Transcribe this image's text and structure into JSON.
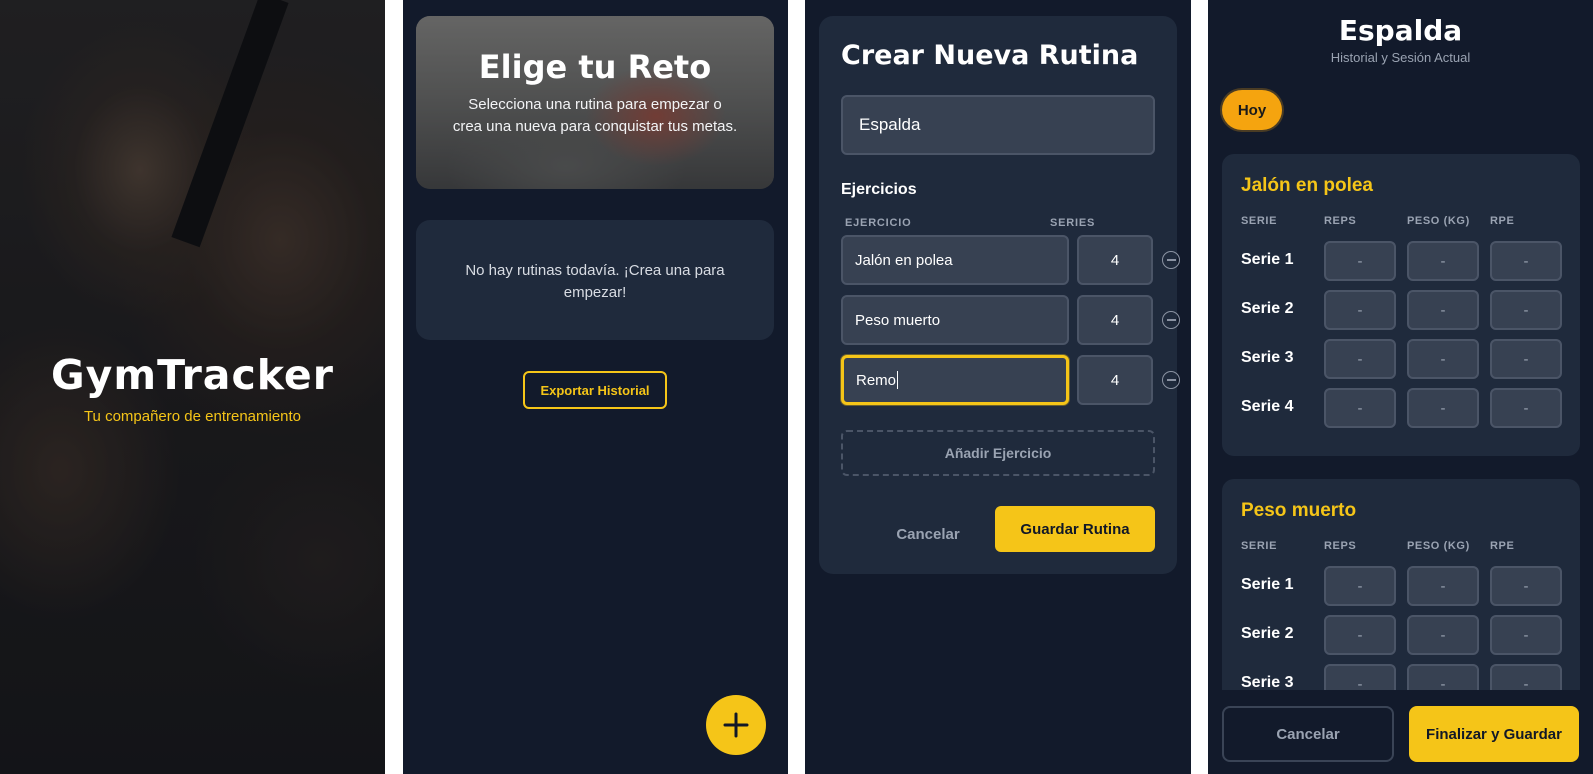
{
  "splash": {
    "title": "GymTracker",
    "subtitle": "Tu compañero de entrenamiento"
  },
  "challenges": {
    "title": "Elige tu Reto",
    "subtitle": "Selecciona una rutina para empezar o crea una nueva para conquistar tus metas.",
    "empty_message": "No hay rutinas todavía. ¡Crea una para empezar!",
    "export_label": "Exportar Historial",
    "fab_icon": "plus-icon"
  },
  "create": {
    "title": "Crear Nueva Rutina",
    "name_value": "Espalda",
    "exercises_label": "Ejercicios",
    "col_exercise": "EJERCICIO",
    "col_series": "SERIES",
    "exercises": [
      {
        "name": "Jalón en polea",
        "series": "4"
      },
      {
        "name": "Peso muerto",
        "series": "4"
      },
      {
        "name": "Remo",
        "series": "4"
      }
    ],
    "add_label": "Añadir Ejercicio",
    "cancel_label": "Cancelar",
    "save_label": "Guardar Rutina"
  },
  "session": {
    "title": "Espalda",
    "subtitle": "Historial y Sesión Actual",
    "today_label": "Hoy",
    "headers": {
      "serie": "SERIE",
      "reps": "REPS",
      "peso": "PESO (KG)",
      "rpe": "RPE"
    },
    "exercises": [
      {
        "name": "Jalón en polea",
        "sets": [
          {
            "label": "Serie 1",
            "reps": "-",
            "peso": "-",
            "rpe": "-"
          },
          {
            "label": "Serie 2",
            "reps": "-",
            "peso": "-",
            "rpe": "-"
          },
          {
            "label": "Serie 3",
            "reps": "-",
            "peso": "-",
            "rpe": "-"
          },
          {
            "label": "Serie 4",
            "reps": "-",
            "peso": "-",
            "rpe": "-"
          }
        ]
      },
      {
        "name": "Peso muerto",
        "sets": [
          {
            "label": "Serie 1",
            "reps": "-",
            "peso": "-",
            "rpe": "-"
          },
          {
            "label": "Serie 2",
            "reps": "-",
            "peso": "-",
            "rpe": "-"
          },
          {
            "label": "Serie 3",
            "reps": "-",
            "peso": "-",
            "rpe": "-"
          }
        ]
      }
    ],
    "cancel_label": "Cancelar",
    "finish_label": "Finalizar y Guardar"
  },
  "colors": {
    "accent": "#f5c518",
    "pill": "#f5a40f",
    "background": "#121a2b",
    "card": "#1f2a3c",
    "input": "#374152"
  }
}
